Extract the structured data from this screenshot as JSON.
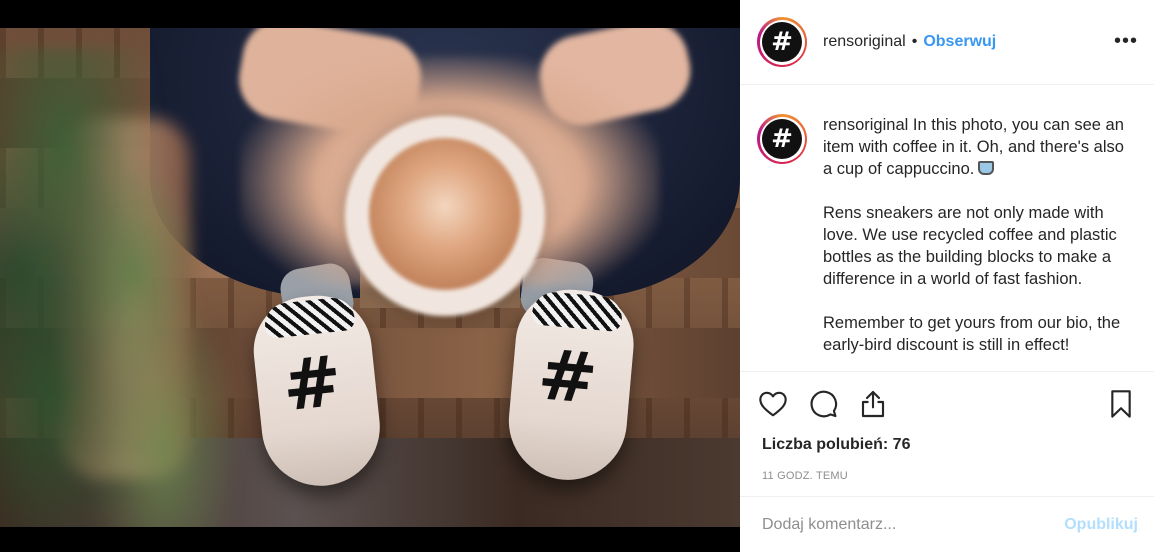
{
  "post": {
    "image_alt": "",
    "logo_glyph": "#"
  },
  "header": {
    "username": "rensoriginal",
    "separator": "•",
    "follow_label": "Obserwuj",
    "more_label": "•••"
  },
  "caption": {
    "username": "rensoriginal",
    "paragraph_1": "In this photo, you can see an item with coffee in it. Oh, and there's also a cup of cappuccino.",
    "paragraph_2": "Rens sneakers are not only made with love. We use recycled coffee and plastic bottles as the building blocks to make a difference in a world of fast fashion.",
    "paragraph_3": "Remember to get yours from our bio, the early-bird discount is still in effect!"
  },
  "actions": {
    "icons": [
      "heart-icon",
      "comment-icon",
      "share-icon",
      "bookmark-icon"
    ],
    "likes_text": "Liczba polubień: 76",
    "time_text": "11 GODZ. TEMU"
  },
  "comment": {
    "placeholder": "Dodaj komentarz...",
    "publish_label": "Opublikuj"
  },
  "colors": {
    "link_blue": "#3897f0",
    "publish_disabled": "#b2dffc",
    "text": "#262626",
    "muted": "#8e8e8e"
  }
}
